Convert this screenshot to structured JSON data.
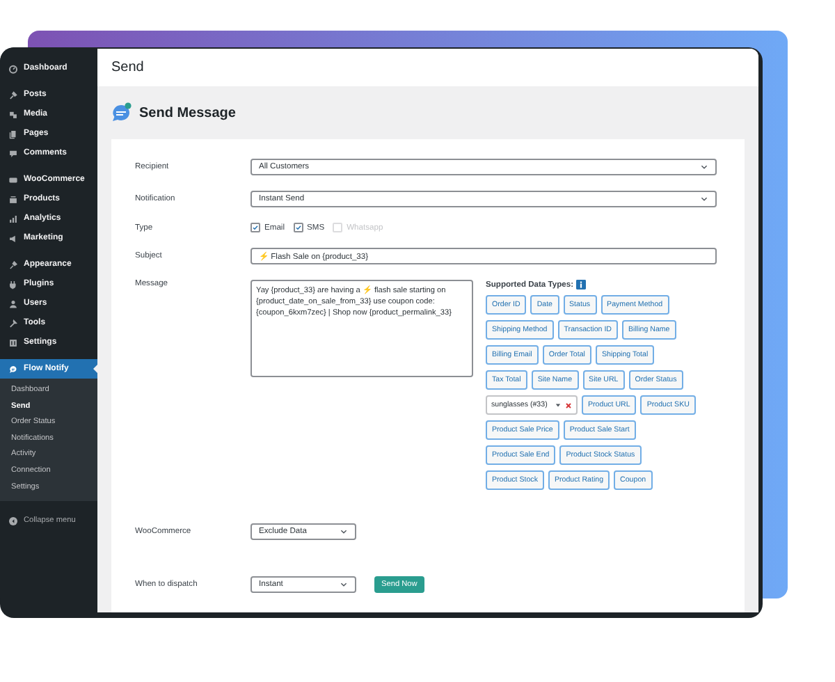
{
  "sidebar": {
    "groups": [
      [
        {
          "label": "Dashboard",
          "selected": false
        }
      ],
      [
        {
          "label": "Posts",
          "selected": false
        },
        {
          "label": "Media",
          "selected": false
        },
        {
          "label": "Pages",
          "selected": false
        },
        {
          "label": "Comments",
          "selected": false
        }
      ],
      [
        {
          "label": "WooCommerce",
          "selected": false
        },
        {
          "label": "Products",
          "selected": false
        },
        {
          "label": "Analytics",
          "selected": false
        },
        {
          "label": "Marketing",
          "selected": false
        }
      ],
      [
        {
          "label": "Appearance",
          "selected": false
        },
        {
          "label": "Plugins",
          "selected": false
        },
        {
          "label": "Users",
          "selected": false
        },
        {
          "label": "Tools",
          "selected": false
        },
        {
          "label": "Settings",
          "selected": false
        }
      ],
      [
        {
          "label": "Flow Notify",
          "selected": true,
          "children": [
            {
              "label": "Dashboard",
              "selected": false
            },
            {
              "label": "Send",
              "selected": true
            },
            {
              "label": "Order Status",
              "selected": false
            },
            {
              "label": "Notifications",
              "selected": false
            },
            {
              "label": "Activity",
              "selected": false
            },
            {
              "label": "Connection",
              "selected": false
            },
            {
              "label": "Settings",
              "selected": false
            }
          ]
        }
      ]
    ],
    "collapse": "Collapse menu"
  },
  "page_title": "Send",
  "heading": "Send Message",
  "fields": [
    {
      "kind": "wideselect",
      "label": "Recipient",
      "value": "All Customers"
    },
    {
      "kind": "wideselect",
      "label": "Notification",
      "value": "Instant Send"
    },
    {
      "kind": "checks",
      "label": "Type",
      "options": [
        {
          "label": "Email",
          "checked": true,
          "disabled": false
        },
        {
          "label": "SMS",
          "checked": true,
          "disabled": false
        },
        {
          "label": "Whatsapp",
          "checked": false,
          "disabled": true
        }
      ]
    },
    {
      "kind": "text",
      "label": "Subject",
      "value": "⚡ Flash Sale on {product_33}"
    },
    {
      "kind": "message",
      "label": "Message",
      "value": "Yay {product_33} are having a ⚡ flash sale starting on {product_date_on_sale_from_33} use coupon code: {coupon_6kxm7zec} | Shop now {product_permalink_33}",
      "data_types": {
        "title": "Supported Data Types:",
        "items": [
          {
            "kind": "tag",
            "label": "Order ID"
          },
          {
            "kind": "tag",
            "label": "Date"
          },
          {
            "kind": "tag",
            "label": "Status"
          },
          {
            "kind": "tag",
            "label": "Payment Method"
          },
          {
            "kind": "tag",
            "label": "Shipping Method"
          },
          {
            "kind": "tag",
            "label": "Transaction ID"
          },
          {
            "kind": "tag",
            "label": "Billing Name"
          },
          {
            "kind": "tag",
            "label": "Billing Email"
          },
          {
            "kind": "tag",
            "label": "Order Total"
          },
          {
            "kind": "tag",
            "label": "Shipping Total"
          },
          {
            "kind": "tag",
            "label": "Tax Total"
          },
          {
            "kind": "tag",
            "label": "Site Name"
          },
          {
            "kind": "tag",
            "label": "Site URL"
          },
          {
            "kind": "tag",
            "label": "Order Status"
          },
          {
            "kind": "product",
            "label": "sunglasses (#33)"
          },
          {
            "kind": "tag",
            "label": "Product URL"
          },
          {
            "kind": "tag",
            "label": "Product SKU"
          },
          {
            "kind": "tag",
            "label": "Product Sale Price"
          },
          {
            "kind": "tag",
            "label": "Product Sale Start"
          },
          {
            "kind": "tag",
            "label": "Product Sale End"
          },
          {
            "kind": "tag",
            "label": "Product Stock Status"
          },
          {
            "kind": "tag",
            "label": "Product Stock"
          },
          {
            "kind": "tag",
            "label": "Product Rating"
          },
          {
            "kind": "tag",
            "label": "Coupon"
          }
        ]
      }
    },
    {
      "kind": "select",
      "label": "WooCommerce",
      "value": "Exclude Data"
    },
    {
      "kind": "select",
      "label": "When to dispatch",
      "value": "Instant",
      "button": "Send Now"
    }
  ]
}
